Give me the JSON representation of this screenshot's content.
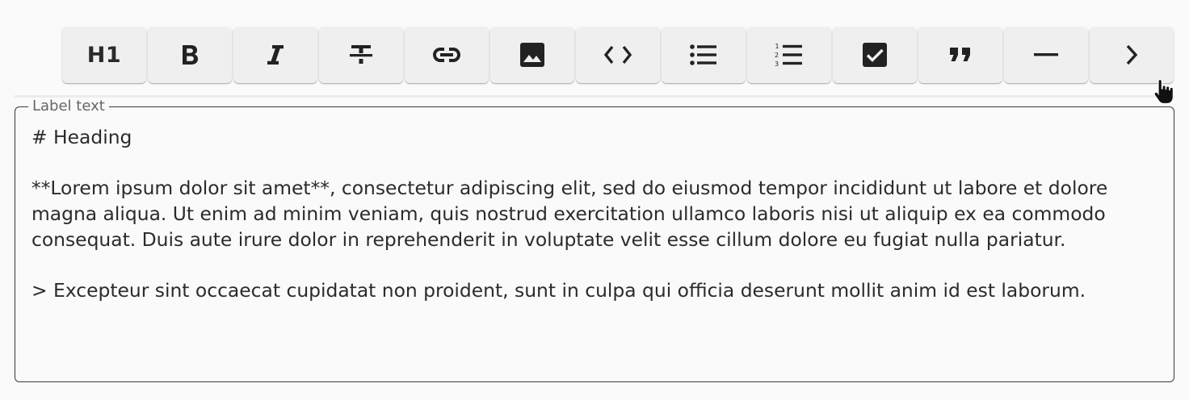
{
  "toolbar": {
    "buttons": [
      {
        "id": "heading",
        "label": "H1",
        "icon": "heading-icon"
      },
      {
        "id": "bold",
        "icon": "bold-icon"
      },
      {
        "id": "italic",
        "icon": "italic-icon"
      },
      {
        "id": "strikethrough",
        "icon": "strikethrough-icon"
      },
      {
        "id": "link",
        "icon": "link-icon"
      },
      {
        "id": "image",
        "icon": "image-icon"
      },
      {
        "id": "code",
        "icon": "code-icon"
      },
      {
        "id": "bulleted-list",
        "icon": "bulleted-list-icon"
      },
      {
        "id": "numbered-list",
        "icon": "numbered-list-icon"
      },
      {
        "id": "checkbox",
        "icon": "checkbox-icon"
      },
      {
        "id": "quote",
        "icon": "quote-icon"
      },
      {
        "id": "horizontal-rule",
        "icon": "horizontal-rule-icon"
      },
      {
        "id": "more",
        "icon": "chevron-right-icon"
      }
    ]
  },
  "editor": {
    "label": "Label text",
    "value": "# Heading\n\n**Lorem ipsum dolor sit amet**, consectetur adipiscing elit, sed do eiusmod tempor incididunt ut labore et dolore magna aliqua. Ut enim ad minim veniam, quis nostrud exercitation ullamco laboris nisi ut aliquip ex ea commodo consequat. Duis aute irure dolor in reprehenderit in voluptate velit esse cillum dolore eu fugiat nulla pariatur.\n\n> Excepteur sint occaecat cupidatat non proident, sunt in culpa qui officia deserunt mollit anim id est laborum."
  },
  "colors": {
    "background": "#fafafa",
    "button_bg": "#efefef",
    "icon": "#222222",
    "border": "#3a3a3a",
    "label": "#666666",
    "text": "#2b2b2b"
  }
}
